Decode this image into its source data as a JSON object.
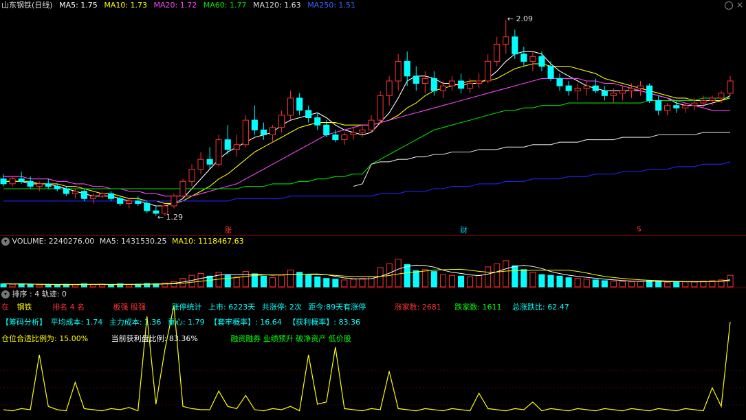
{
  "header": {
    "title": "山东钢铁(日线)",
    "ma5": "MA5: 1.75",
    "ma10": "MA10: 1.73",
    "ma20": "MA20: 1.72",
    "ma60": "MA60: 1.77",
    "ma120": "MA120: 1.63",
    "ma250": "MA250: 1.51"
  },
  "colors": {
    "ma5": "#ffffff",
    "ma10": "#ffff00",
    "ma20": "#ff44ff",
    "ma60": "#00e000",
    "ma120": "#dddddd",
    "ma250": "#2222ff",
    "up": "#ff3333",
    "down": "#00ffff"
  },
  "price_labels": {
    "high": "2.09",
    "low": "1.29"
  },
  "markers": [
    "涨",
    "财",
    "$"
  ],
  "volume_header": {
    "volume": "VOLUME: 2240276.00",
    "ma5": "MA5: 1431530.25",
    "ma10": "MA10: 1118467.63"
  },
  "indicator_header": "排序 : 4 轨迹: 0",
  "info_row1": {
    "zai": "在",
    "gangtie": "钢铁",
    "rank": "排名 4   名",
    "bankuai": "板强   股强",
    "zhangting": "涨停统计",
    "shangshi": "上市: 6223天",
    "gong": "共涨停: 2次",
    "juli": "距今:89天有涨停",
    "up_count": "涨家数: 2681",
    "down_count": "跌家数: 1611",
    "ratio": "总涨跌比: 62.47"
  },
  "info_row2": {
    "chouma": "【筹码分析】",
    "avg": "平均成本: 1.74",
    "main": "主力成本: 1.36",
    "center": "重心: 1.79",
    "tao": "【套牢概率】: 16.64",
    "huo": "【获利概率】: 83.36"
  },
  "info_row3": {
    "position": "仓位合适比例为: 15.00%",
    "profit": "当前获利盘比例: 83.36%",
    "tags": "融资融券 业绩预升 破净资产 低价股"
  },
  "chart_data": {
    "type": "candlestick",
    "ylim": [
      1.26,
      2.12
    ],
    "ohlc": [
      [
        1.44,
        1.46,
        1.41,
        1.42
      ],
      [
        1.42,
        1.45,
        1.41,
        1.44
      ],
      [
        1.44,
        1.47,
        1.42,
        1.43
      ],
      [
        1.43,
        1.45,
        1.4,
        1.41
      ],
      [
        1.41,
        1.43,
        1.39,
        1.42
      ],
      [
        1.42,
        1.44,
        1.4,
        1.41
      ],
      [
        1.41,
        1.42,
        1.39,
        1.4
      ],
      [
        1.4,
        1.41,
        1.37,
        1.38
      ],
      [
        1.38,
        1.4,
        1.36,
        1.39
      ],
      [
        1.39,
        1.4,
        1.35,
        1.36
      ],
      [
        1.36,
        1.38,
        1.34,
        1.37
      ],
      [
        1.37,
        1.39,
        1.36,
        1.38
      ],
      [
        1.38,
        1.39,
        1.35,
        1.36
      ],
      [
        1.36,
        1.37,
        1.33,
        1.34
      ],
      [
        1.34,
        1.36,
        1.32,
        1.35
      ],
      [
        1.35,
        1.37,
        1.33,
        1.34
      ],
      [
        1.34,
        1.35,
        1.3,
        1.31
      ],
      [
        1.31,
        1.33,
        1.29,
        1.3
      ],
      [
        1.3,
        1.34,
        1.29,
        1.33
      ],
      [
        1.33,
        1.38,
        1.32,
        1.37
      ],
      [
        1.37,
        1.44,
        1.36,
        1.43
      ],
      [
        1.43,
        1.5,
        1.41,
        1.48
      ],
      [
        1.48,
        1.55,
        1.46,
        1.52
      ],
      [
        1.52,
        1.57,
        1.48,
        1.5
      ],
      [
        1.5,
        1.62,
        1.49,
        1.6
      ],
      [
        1.6,
        1.66,
        1.54,
        1.56
      ],
      [
        1.56,
        1.62,
        1.53,
        1.58
      ],
      [
        1.58,
        1.7,
        1.57,
        1.68
      ],
      [
        1.68,
        1.74,
        1.62,
        1.64
      ],
      [
        1.64,
        1.67,
        1.6,
        1.62
      ],
      [
        1.62,
        1.66,
        1.59,
        1.65
      ],
      [
        1.65,
        1.72,
        1.63,
        1.7
      ],
      [
        1.7,
        1.8,
        1.68,
        1.77
      ],
      [
        1.77,
        1.79,
        1.7,
        1.72
      ],
      [
        1.72,
        1.74,
        1.67,
        1.69
      ],
      [
        1.69,
        1.71,
        1.64,
        1.66
      ],
      [
        1.66,
        1.68,
        1.61,
        1.62
      ],
      [
        1.62,
        1.64,
        1.59,
        1.6
      ],
      [
        1.6,
        1.63,
        1.58,
        1.62
      ],
      [
        1.62,
        1.65,
        1.6,
        1.63
      ],
      [
        1.63,
        1.66,
        1.61,
        1.64
      ],
      [
        1.64,
        1.7,
        1.63,
        1.68
      ],
      [
        1.68,
        1.8,
        1.67,
        1.78
      ],
      [
        1.78,
        1.86,
        1.74,
        1.84
      ],
      [
        1.84,
        1.95,
        1.8,
        1.92
      ],
      [
        1.92,
        1.96,
        1.82,
        1.86
      ],
      [
        1.86,
        1.9,
        1.8,
        1.83
      ],
      [
        1.83,
        1.88,
        1.79,
        1.85
      ],
      [
        1.85,
        1.88,
        1.78,
        1.8
      ],
      [
        1.8,
        1.84,
        1.77,
        1.82
      ],
      [
        1.82,
        1.86,
        1.8,
        1.84
      ],
      [
        1.84,
        1.87,
        1.79,
        1.81
      ],
      [
        1.81,
        1.85,
        1.79,
        1.83
      ],
      [
        1.83,
        1.87,
        1.81,
        1.84
      ],
      [
        1.84,
        1.95,
        1.83,
        1.92
      ],
      [
        1.92,
        2.02,
        1.9,
        1.99
      ],
      [
        1.99,
        2.09,
        1.95,
        2.02
      ],
      [
        2.02,
        2.05,
        1.93,
        1.95
      ],
      [
        1.95,
        1.98,
        1.9,
        1.92
      ],
      [
        1.92,
        1.96,
        1.88,
        1.94
      ],
      [
        1.94,
        1.96,
        1.88,
        1.9
      ],
      [
        1.9,
        1.92,
        1.84,
        1.85
      ],
      [
        1.85,
        1.87,
        1.8,
        1.82
      ],
      [
        1.82,
        1.84,
        1.78,
        1.8
      ],
      [
        1.8,
        1.83,
        1.76,
        1.81
      ],
      [
        1.81,
        1.84,
        1.78,
        1.82
      ],
      [
        1.82,
        1.85,
        1.79,
        1.8
      ],
      [
        1.8,
        1.82,
        1.76,
        1.78
      ],
      [
        1.78,
        1.81,
        1.75,
        1.79
      ],
      [
        1.79,
        1.82,
        1.76,
        1.8
      ],
      [
        1.8,
        1.83,
        1.77,
        1.81
      ],
      [
        1.81,
        1.84,
        1.78,
        1.82
      ],
      [
        1.82,
        1.83,
        1.75,
        1.76
      ],
      [
        1.76,
        1.78,
        1.7,
        1.72
      ],
      [
        1.72,
        1.75,
        1.7,
        1.74
      ],
      [
        1.74,
        1.76,
        1.71,
        1.73
      ],
      [
        1.73,
        1.75,
        1.71,
        1.74
      ],
      [
        1.74,
        1.77,
        1.72,
        1.75
      ],
      [
        1.75,
        1.78,
        1.73,
        1.76
      ],
      [
        1.76,
        1.78,
        1.74,
        1.77
      ],
      [
        1.77,
        1.8,
        1.75,
        1.79
      ],
      [
        1.79,
        1.86,
        1.78,
        1.84
      ]
    ],
    "ma_series": {
      "ma5": [
        1.43,
        1.43,
        1.43,
        1.42,
        1.42,
        1.42,
        1.41,
        1.4,
        1.39,
        1.38,
        1.37,
        1.37,
        1.37,
        1.36,
        1.35,
        1.35,
        1.34,
        1.33,
        1.33,
        1.34,
        1.36,
        1.4,
        1.44,
        1.48,
        1.52,
        1.55,
        1.57,
        1.59,
        1.61,
        1.62,
        1.63,
        1.66,
        1.68,
        1.69,
        1.7,
        1.71,
        1.69,
        1.66,
        1.64,
        1.63,
        1.62,
        1.63,
        1.67,
        1.71,
        1.77,
        1.84,
        1.86,
        1.86,
        1.85,
        1.83,
        1.83,
        1.82,
        1.83,
        1.83,
        1.85,
        1.88,
        1.92,
        1.95,
        1.96,
        1.96,
        1.95,
        1.91,
        1.88,
        1.86,
        1.84,
        1.82,
        1.81,
        1.8,
        1.8,
        1.8,
        1.8,
        1.8,
        1.79,
        1.78,
        1.77,
        1.75,
        1.74,
        1.74,
        1.74,
        1.75,
        1.76,
        1.78
      ],
      "ma10": [
        1.43,
        1.43,
        1.43,
        1.43,
        1.42,
        1.42,
        1.42,
        1.41,
        1.41,
        1.4,
        1.39,
        1.38,
        1.38,
        1.37,
        1.36,
        1.36,
        1.35,
        1.35,
        1.34,
        1.34,
        1.35,
        1.37,
        1.39,
        1.41,
        1.44,
        1.46,
        1.49,
        1.52,
        1.55,
        1.57,
        1.59,
        1.61,
        1.63,
        1.65,
        1.66,
        1.67,
        1.67,
        1.67,
        1.66,
        1.66,
        1.66,
        1.66,
        1.67,
        1.68,
        1.7,
        1.73,
        1.75,
        1.78,
        1.8,
        1.81,
        1.82,
        1.83,
        1.84,
        1.84,
        1.84,
        1.85,
        1.87,
        1.89,
        1.9,
        1.91,
        1.91,
        1.9,
        1.9,
        1.9,
        1.89,
        1.88,
        1.87,
        1.85,
        1.84,
        1.83,
        1.82,
        1.81,
        1.8,
        1.79,
        1.78,
        1.77,
        1.77,
        1.76,
        1.76,
        1.76,
        1.76,
        1.77
      ],
      "ma20": [
        1.45,
        1.45,
        1.45,
        1.44,
        1.44,
        1.44,
        1.43,
        1.43,
        1.42,
        1.42,
        1.41,
        1.41,
        1.4,
        1.4,
        1.39,
        1.39,
        1.38,
        1.38,
        1.37,
        1.37,
        1.37,
        1.37,
        1.38,
        1.39,
        1.4,
        1.41,
        1.42,
        1.44,
        1.46,
        1.48,
        1.5,
        1.52,
        1.54,
        1.56,
        1.58,
        1.6,
        1.62,
        1.63,
        1.64,
        1.65,
        1.66,
        1.66,
        1.67,
        1.68,
        1.69,
        1.7,
        1.71,
        1.72,
        1.73,
        1.74,
        1.75,
        1.76,
        1.77,
        1.78,
        1.79,
        1.8,
        1.81,
        1.82,
        1.83,
        1.84,
        1.85,
        1.85,
        1.85,
        1.85,
        1.85,
        1.84,
        1.84,
        1.83,
        1.83,
        1.82,
        1.81,
        1.8,
        1.79,
        1.78,
        1.77,
        1.76,
        1.75,
        1.74,
        1.73,
        1.72,
        1.72,
        1.72
      ],
      "ma60": [
        1.4,
        1.4,
        1.4,
        1.4,
        1.4,
        1.4,
        1.4,
        1.4,
        1.4,
        1.4,
        1.4,
        1.4,
        1.4,
        1.4,
        1.4,
        1.4,
        1.4,
        1.4,
        1.4,
        1.4,
        1.4,
        1.4,
        1.4,
        1.4,
        1.4,
        1.4,
        1.4,
        1.41,
        1.41,
        1.41,
        1.42,
        1.42,
        1.42,
        1.43,
        1.43,
        1.44,
        1.44,
        1.45,
        1.45,
        1.46,
        1.46,
        1.5,
        1.52,
        1.54,
        1.56,
        1.58,
        1.6,
        1.62,
        1.64,
        1.65,
        1.66,
        1.67,
        1.68,
        1.69,
        1.7,
        1.71,
        1.72,
        1.72,
        1.73,
        1.73,
        1.74,
        1.74,
        1.74,
        1.75,
        1.75,
        1.75,
        1.75,
        1.75,
        1.75,
        1.75,
        1.75,
        1.75,
        1.76,
        1.76,
        1.76,
        1.76,
        1.76,
        1.76,
        1.77,
        1.77,
        1.77,
        1.77
      ],
      "ma120": [
        null,
        null,
        null,
        null,
        null,
        null,
        null,
        null,
        null,
        null,
        null,
        null,
        null,
        null,
        null,
        null,
        null,
        null,
        null,
        null,
        null,
        null,
        null,
        null,
        null,
        null,
        null,
        null,
        null,
        null,
        null,
        null,
        null,
        null,
        null,
        null,
        null,
        null,
        null,
        1.41,
        1.42,
        1.5,
        1.51,
        1.51,
        1.52,
        1.52,
        1.53,
        1.53,
        1.54,
        1.54,
        1.55,
        1.55,
        1.55,
        1.56,
        1.56,
        1.56,
        1.57,
        1.57,
        1.57,
        1.58,
        1.58,
        1.58,
        1.59,
        1.59,
        1.59,
        1.6,
        1.6,
        1.6,
        1.6,
        1.61,
        1.61,
        1.61,
        1.61,
        1.62,
        1.62,
        1.62,
        1.62,
        1.62,
        1.63,
        1.63,
        1.63,
        1.63
      ],
      "ma250": [
        1.35,
        1.35,
        1.35,
        1.35,
        1.35,
        1.35,
        1.35,
        1.35,
        1.35,
        1.35,
        1.35,
        1.35,
        1.35,
        1.35,
        1.35,
        1.35,
        1.35,
        1.35,
        1.35,
        1.35,
        1.35,
        1.35,
        1.35,
        1.35,
        1.35,
        1.35,
        1.36,
        1.36,
        1.36,
        1.36,
        1.36,
        1.36,
        1.37,
        1.37,
        1.37,
        1.37,
        1.37,
        1.37,
        1.37,
        1.37,
        1.37,
        1.37,
        1.38,
        1.38,
        1.38,
        1.39,
        1.39,
        1.39,
        1.4,
        1.4,
        1.41,
        1.41,
        1.41,
        1.42,
        1.42,
        1.42,
        1.43,
        1.43,
        1.43,
        1.44,
        1.44,
        1.44,
        1.44,
        1.45,
        1.45,
        1.45,
        1.46,
        1.46,
        1.46,
        1.47,
        1.47,
        1.47,
        1.48,
        1.48,
        1.48,
        1.49,
        1.49,
        1.49,
        1.5,
        1.5,
        1.5,
        1.51
      ]
    },
    "volume_ratio": [
      0.08,
      0.07,
      0.08,
      0.06,
      0.05,
      0.06,
      0.05,
      0.07,
      0.06,
      0.08,
      0.06,
      0.07,
      0.05,
      0.08,
      0.06,
      0.07,
      0.09,
      0.08,
      0.1,
      0.14,
      0.22,
      0.3,
      0.35,
      0.28,
      0.38,
      0.3,
      0.26,
      0.4,
      0.34,
      0.28,
      0.24,
      0.3,
      0.44,
      0.38,
      0.3,
      0.26,
      0.22,
      0.2,
      0.18,
      0.2,
      0.22,
      0.26,
      0.5,
      0.6,
      0.72,
      0.58,
      0.42,
      0.45,
      0.4,
      0.32,
      0.3,
      0.28,
      0.26,
      0.3,
      0.52,
      0.6,
      0.68,
      0.55,
      0.45,
      0.38,
      0.32,
      0.3,
      0.28,
      0.24,
      0.22,
      0.2,
      0.18,
      0.16,
      0.15,
      0.14,
      0.13,
      0.14,
      0.16,
      0.14,
      0.12,
      0.12,
      0.13,
      0.14,
      0.15,
      0.16,
      0.18,
      0.3
    ],
    "indicator": [
      0.05,
      0.04,
      0.06,
      0.05,
      0.55,
      0.08,
      0.05,
      0.04,
      0.3,
      0.06,
      0.05,
      0.04,
      0.06,
      0.05,
      0.07,
      0.04,
      0.9,
      0.1,
      0.6,
      1.0,
      0.08,
      0.06,
      0.05,
      0.05,
      0.22,
      0.08,
      0.06,
      0.18,
      0.05,
      0.04,
      0.06,
      0.05,
      0.08,
      0.04,
      0.55,
      0.1,
      0.12,
      0.62,
      0.06,
      0.05,
      0.04,
      0.06,
      0.05,
      0.4,
      0.06,
      0.05,
      0.04,
      0.06,
      0.05,
      0.04,
      0.06,
      0.05,
      0.04,
      0.2,
      0.06,
      0.05,
      0.04,
      0.06,
      0.05,
      0.12,
      0.04,
      0.06,
      0.05,
      0.04,
      0.06,
      0.05,
      0.04,
      0.06,
      0.05,
      0.04,
      0.06,
      0.05,
      0.04,
      0.06,
      0.05,
      0.04,
      0.06,
      0.05,
      0.04,
      0.25,
      0.08,
      0.85
    ]
  }
}
